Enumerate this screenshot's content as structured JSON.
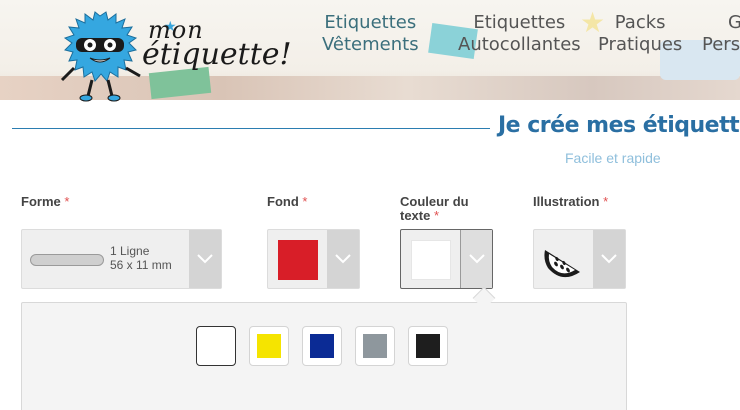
{
  "brand": {
    "logo_text_line1": "mon",
    "logo_text_line2": "étiquette!"
  },
  "nav": {
    "items": [
      {
        "line1": "Etiquettes",
        "line2": "Vêtements"
      },
      {
        "line1": "Etiquettes",
        "line2": "Autocollantes"
      },
      {
        "line1": "Packs",
        "line2": "Pratiques"
      },
      {
        "line1": "G",
        "line2": "Perso"
      }
    ]
  },
  "page": {
    "title": "Je crée mes étiquettes",
    "subtitle": "Facile et rapide"
  },
  "options": {
    "forme": {
      "label": "Forme",
      "required": "*",
      "value_line1": "1 Ligne",
      "value_line2": "56 x 11 mm"
    },
    "fond": {
      "label": "Fond",
      "required": "*",
      "value_color": "#d81e28"
    },
    "couleur_texte": {
      "label_line1": "Couleur du",
      "label_line2": "texte",
      "required": "*",
      "value_color": "#ffffff"
    },
    "illustration": {
      "label": "Illustration",
      "required": "*",
      "value_icon": "watermelon-icon"
    }
  },
  "text_color_swatches": [
    {
      "name": "white",
      "color": "#ffffff",
      "selected": true
    },
    {
      "name": "yellow",
      "color": "#f5e400"
    },
    {
      "name": "navy",
      "color": "#0b2b95"
    },
    {
      "name": "grey",
      "color": "#8e979d"
    },
    {
      "name": "black",
      "color": "#1e1e1e"
    }
  ],
  "colors": {
    "accent": "#2a6fa3",
    "required": "#e05050"
  }
}
